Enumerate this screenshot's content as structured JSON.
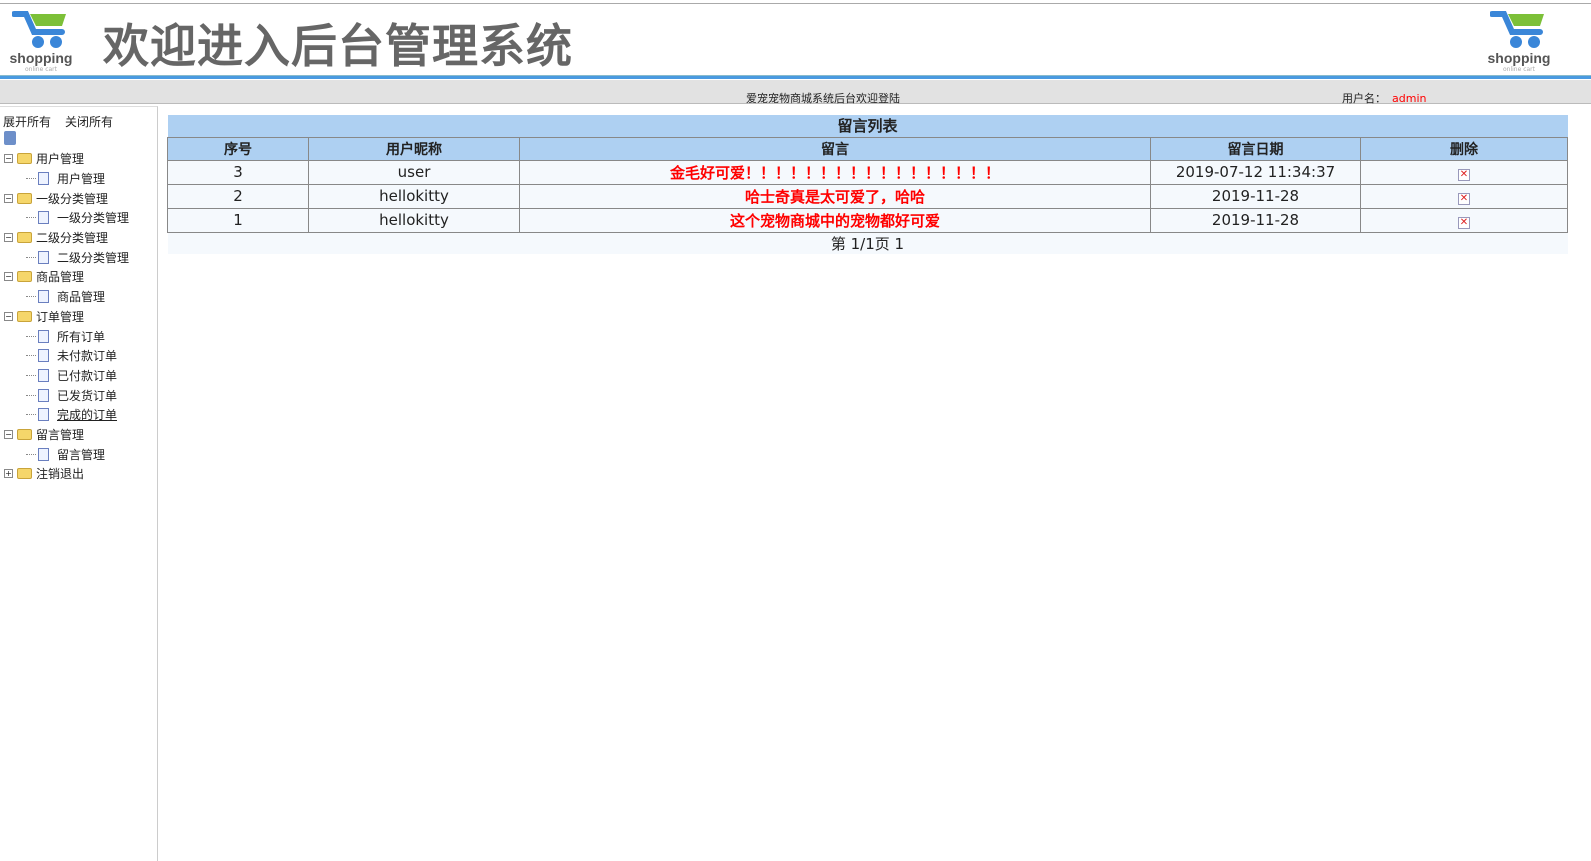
{
  "header": {
    "title": "欢迎进入后台管理系统",
    "logo_text": "shopping",
    "logo_sub": "online cart"
  },
  "topbar": {
    "welcome": "爱宠宠物商城系统后台欢迎登陆",
    "user_label": "用户名：",
    "user_name": "admin"
  },
  "sidebar": {
    "expand_all": "展开所有",
    "collapse_all": "关闭所有",
    "groups": [
      {
        "label": "用户管理",
        "items": [
          "用户管理"
        ]
      },
      {
        "label": "一级分类管理",
        "items": [
          "一级分类管理"
        ]
      },
      {
        "label": "二级分类管理",
        "items": [
          "二级分类管理"
        ]
      },
      {
        "label": "商品管理",
        "items": [
          "商品管理"
        ]
      },
      {
        "label": "订单管理",
        "items": [
          "所有订单",
          "未付款订单",
          "已付款订单",
          "已发货订单",
          "完成的订单"
        ]
      },
      {
        "label": "留言管理",
        "items": [
          "留言管理"
        ]
      },
      {
        "label": "注销退出",
        "items": []
      }
    ]
  },
  "table": {
    "caption": "留言列表",
    "headers": [
      "序号",
      "用户昵称",
      "留言",
      "留言日期",
      "删除"
    ],
    "rows": [
      {
        "id": "3",
        "nick": "user",
        "msg": "金毛好可爱！！！！！！！！！！！！！！！！！",
        "date": "2019-07-12 11:34:37"
      },
      {
        "id": "2",
        "nick": "hellokitty",
        "msg": "哈士奇真是太可爱了，哈哈",
        "date": "2019-11-28"
      },
      {
        "id": "1",
        "nick": "hellokitty",
        "msg": "这个宠物商城中的宠物都好可爱",
        "date": "2019-11-28"
      }
    ],
    "pager": "第 1/1页 1"
  }
}
